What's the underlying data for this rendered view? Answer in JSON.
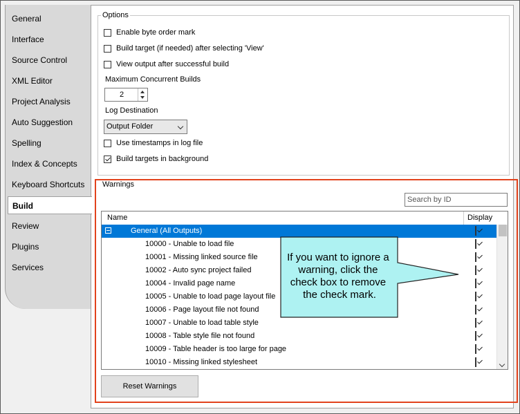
{
  "tabs": [
    {
      "label": "General",
      "active": false
    },
    {
      "label": "Interface",
      "active": false
    },
    {
      "label": "Source Control",
      "active": false
    },
    {
      "label": "XML Editor",
      "active": false
    },
    {
      "label": "Project Analysis",
      "active": false
    },
    {
      "label": "Auto Suggestion",
      "active": false
    },
    {
      "label": "Spelling",
      "active": false
    },
    {
      "label": "Index & Concepts",
      "active": false
    },
    {
      "label": "Keyboard Shortcuts",
      "active": false
    },
    {
      "label": "Build",
      "active": true
    },
    {
      "label": "Review",
      "active": false
    },
    {
      "label": "Plugins",
      "active": false
    },
    {
      "label": "Services",
      "active": false
    }
  ],
  "options": {
    "title": "Options",
    "enable_bom": {
      "label": "Enable byte order mark",
      "checked": false
    },
    "build_target": {
      "label": "Build target (if needed) after selecting 'View'",
      "checked": false
    },
    "view_output": {
      "label": "View output after successful build",
      "checked": false
    },
    "max_builds_label": "Maximum Concurrent Builds",
    "max_builds_value": "2",
    "log_destination_label": "Log Destination",
    "log_destination_value": "Output Folder",
    "timestamps": {
      "label": "Use timestamps in log file",
      "checked": false
    },
    "background": {
      "label": "Build targets in background",
      "checked": true
    }
  },
  "warnings": {
    "title": "Warnings",
    "search_placeholder": "Search by ID",
    "col_name": "Name",
    "col_display": "Display",
    "group": "General (All Outputs)",
    "rows": [
      "10000 - Unable to load file",
      "10001 - Missing linked source file",
      "10002 - Auto sync project failed",
      "10004 - Invalid page name",
      "10005 - Unable to load page layout file",
      "10006 - Page layout file not found",
      "10007 - Unable to load table style",
      "10008 - Table style file not found",
      "10009 - Table header is too large for page",
      "10010 - Missing linked stylesheet"
    ],
    "reset_label": "Reset Warnings"
  },
  "callout": {
    "lines": [
      "If you want to ignore a",
      "warning, click the",
      "check box to remove",
      "the check mark."
    ],
    "fill": "#aef2f2",
    "stroke": "#222222"
  },
  "colors": {
    "highlight_border": "#e2421c",
    "selection": "#0078d7"
  }
}
